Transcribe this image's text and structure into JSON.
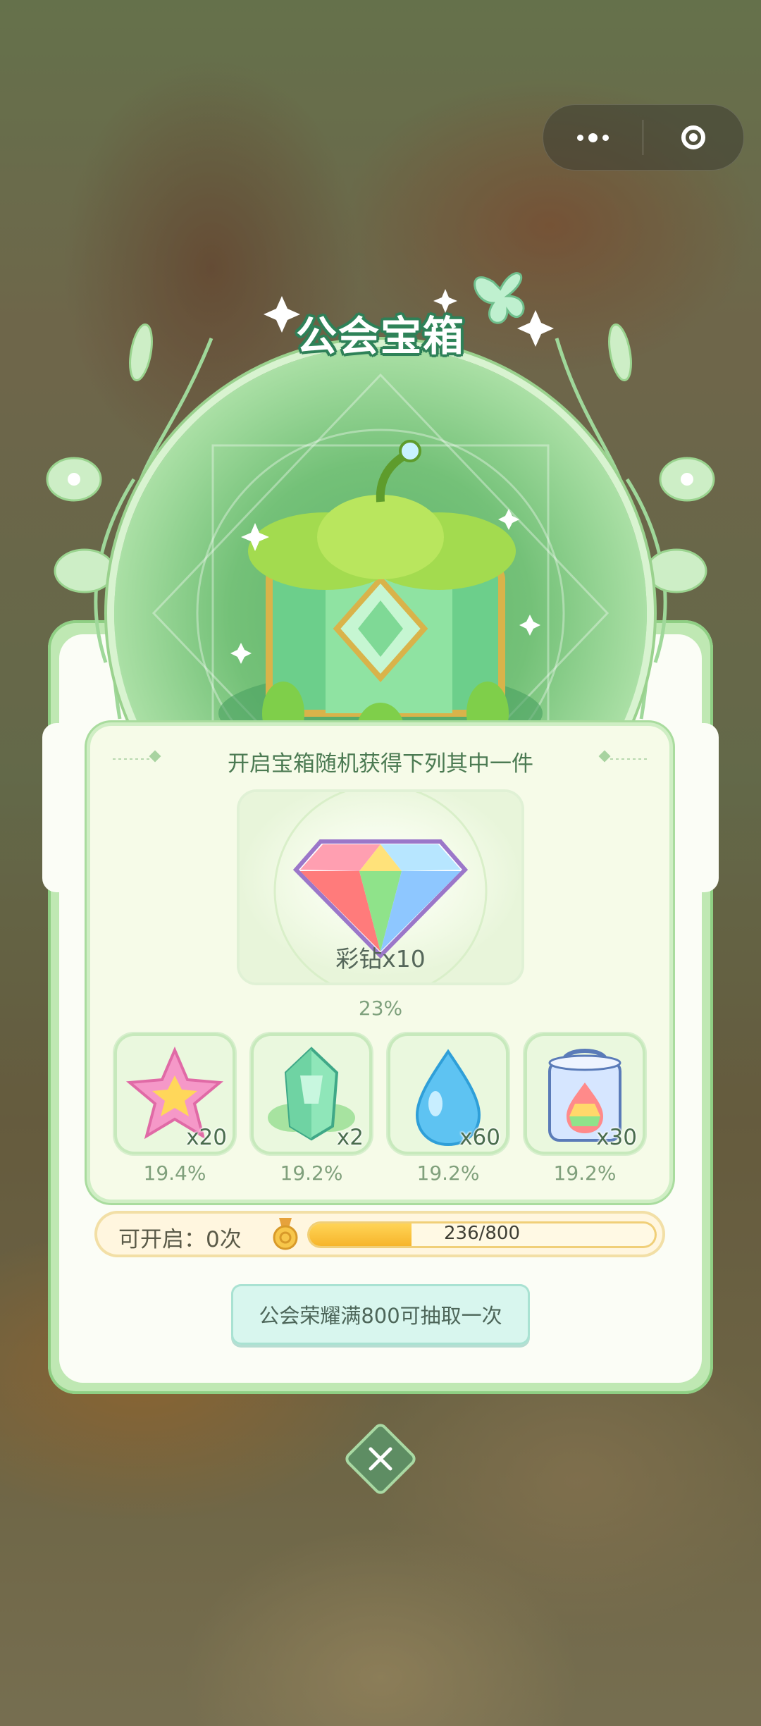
{
  "header": {
    "more_icon": "more-dots-icon",
    "close_icon": "target-circle-icon"
  },
  "modal": {
    "title": "公会宝箱",
    "subtitle": "开启宝箱随机获得下列其中一件",
    "main_prize": {
      "name": "彩钻x10",
      "probability": "23%",
      "icon": "rainbow-diamond-icon"
    },
    "items": [
      {
        "icon": "pink-star-icon",
        "quantity": "x20",
        "probability": "19.4%"
      },
      {
        "icon": "green-crystal-icon",
        "quantity": "x2",
        "probability": "19.2%"
      },
      {
        "icon": "blue-water-drop-icon",
        "quantity": "x60",
        "probability": "19.2%"
      },
      {
        "icon": "rainbow-paint-bucket-icon",
        "quantity": "x30",
        "probability": "19.2%"
      }
    ],
    "progress": {
      "label": "可开启：0次",
      "current": 236,
      "max": 800,
      "text": "236/800"
    },
    "button_label": "公会荣耀满800可抽取一次"
  },
  "colors": {
    "accent_green": "#5e8d63",
    "progress_fill": "#f6b52b",
    "button_bg": "#d8f6ee"
  }
}
